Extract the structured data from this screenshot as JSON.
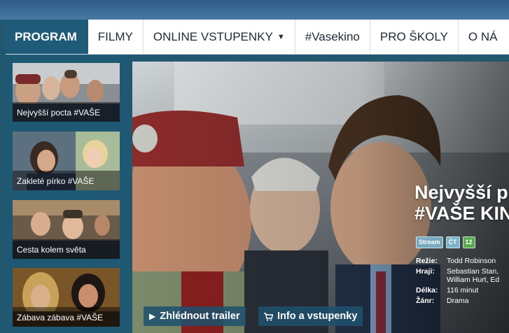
{
  "nav": {
    "items": [
      {
        "label": "PROGRAM",
        "active": true
      },
      {
        "label": "FILMY"
      },
      {
        "label": "ONLINE VSTUPENKY",
        "dropdown": true
      },
      {
        "label": "#Vasekino"
      },
      {
        "label": "PRO ŠKOLY"
      },
      {
        "label": "O NÁ"
      }
    ],
    "dropdown_icon": "chevron-down-icon"
  },
  "sidebar": {
    "items": [
      {
        "title": "Nejvyšší pocta #VAŠE"
      },
      {
        "title": "Zakleté pírko #VAŠE"
      },
      {
        "title": "Cesta kolem světa"
      },
      {
        "title": "Zábava zábava #VAŠE"
      }
    ]
  },
  "hero": {
    "title_line1": "Nejvyšší p",
    "title_line2": "#VAŠE KIN",
    "badges": {
      "stream": "Stream",
      "ct": "ČT",
      "age": "12"
    },
    "details": [
      {
        "label": "Režie:",
        "value": "Todd Robinson"
      },
      {
        "label": "Hrají:",
        "value": "Sebastian Stan,\nWilliam Hurt, Ed"
      },
      {
        "label": "Délka:",
        "value": "116 minut"
      },
      {
        "label": "Žánr:",
        "value": "Drama"
      }
    ],
    "trailer_button": "Zhlédnout trailer",
    "info_button": "Info a vstupenky"
  },
  "colors": {
    "nav_active": "#1f5b79",
    "sidebar_bg": "#1f5873",
    "badge_age": "#5aa84f"
  }
}
